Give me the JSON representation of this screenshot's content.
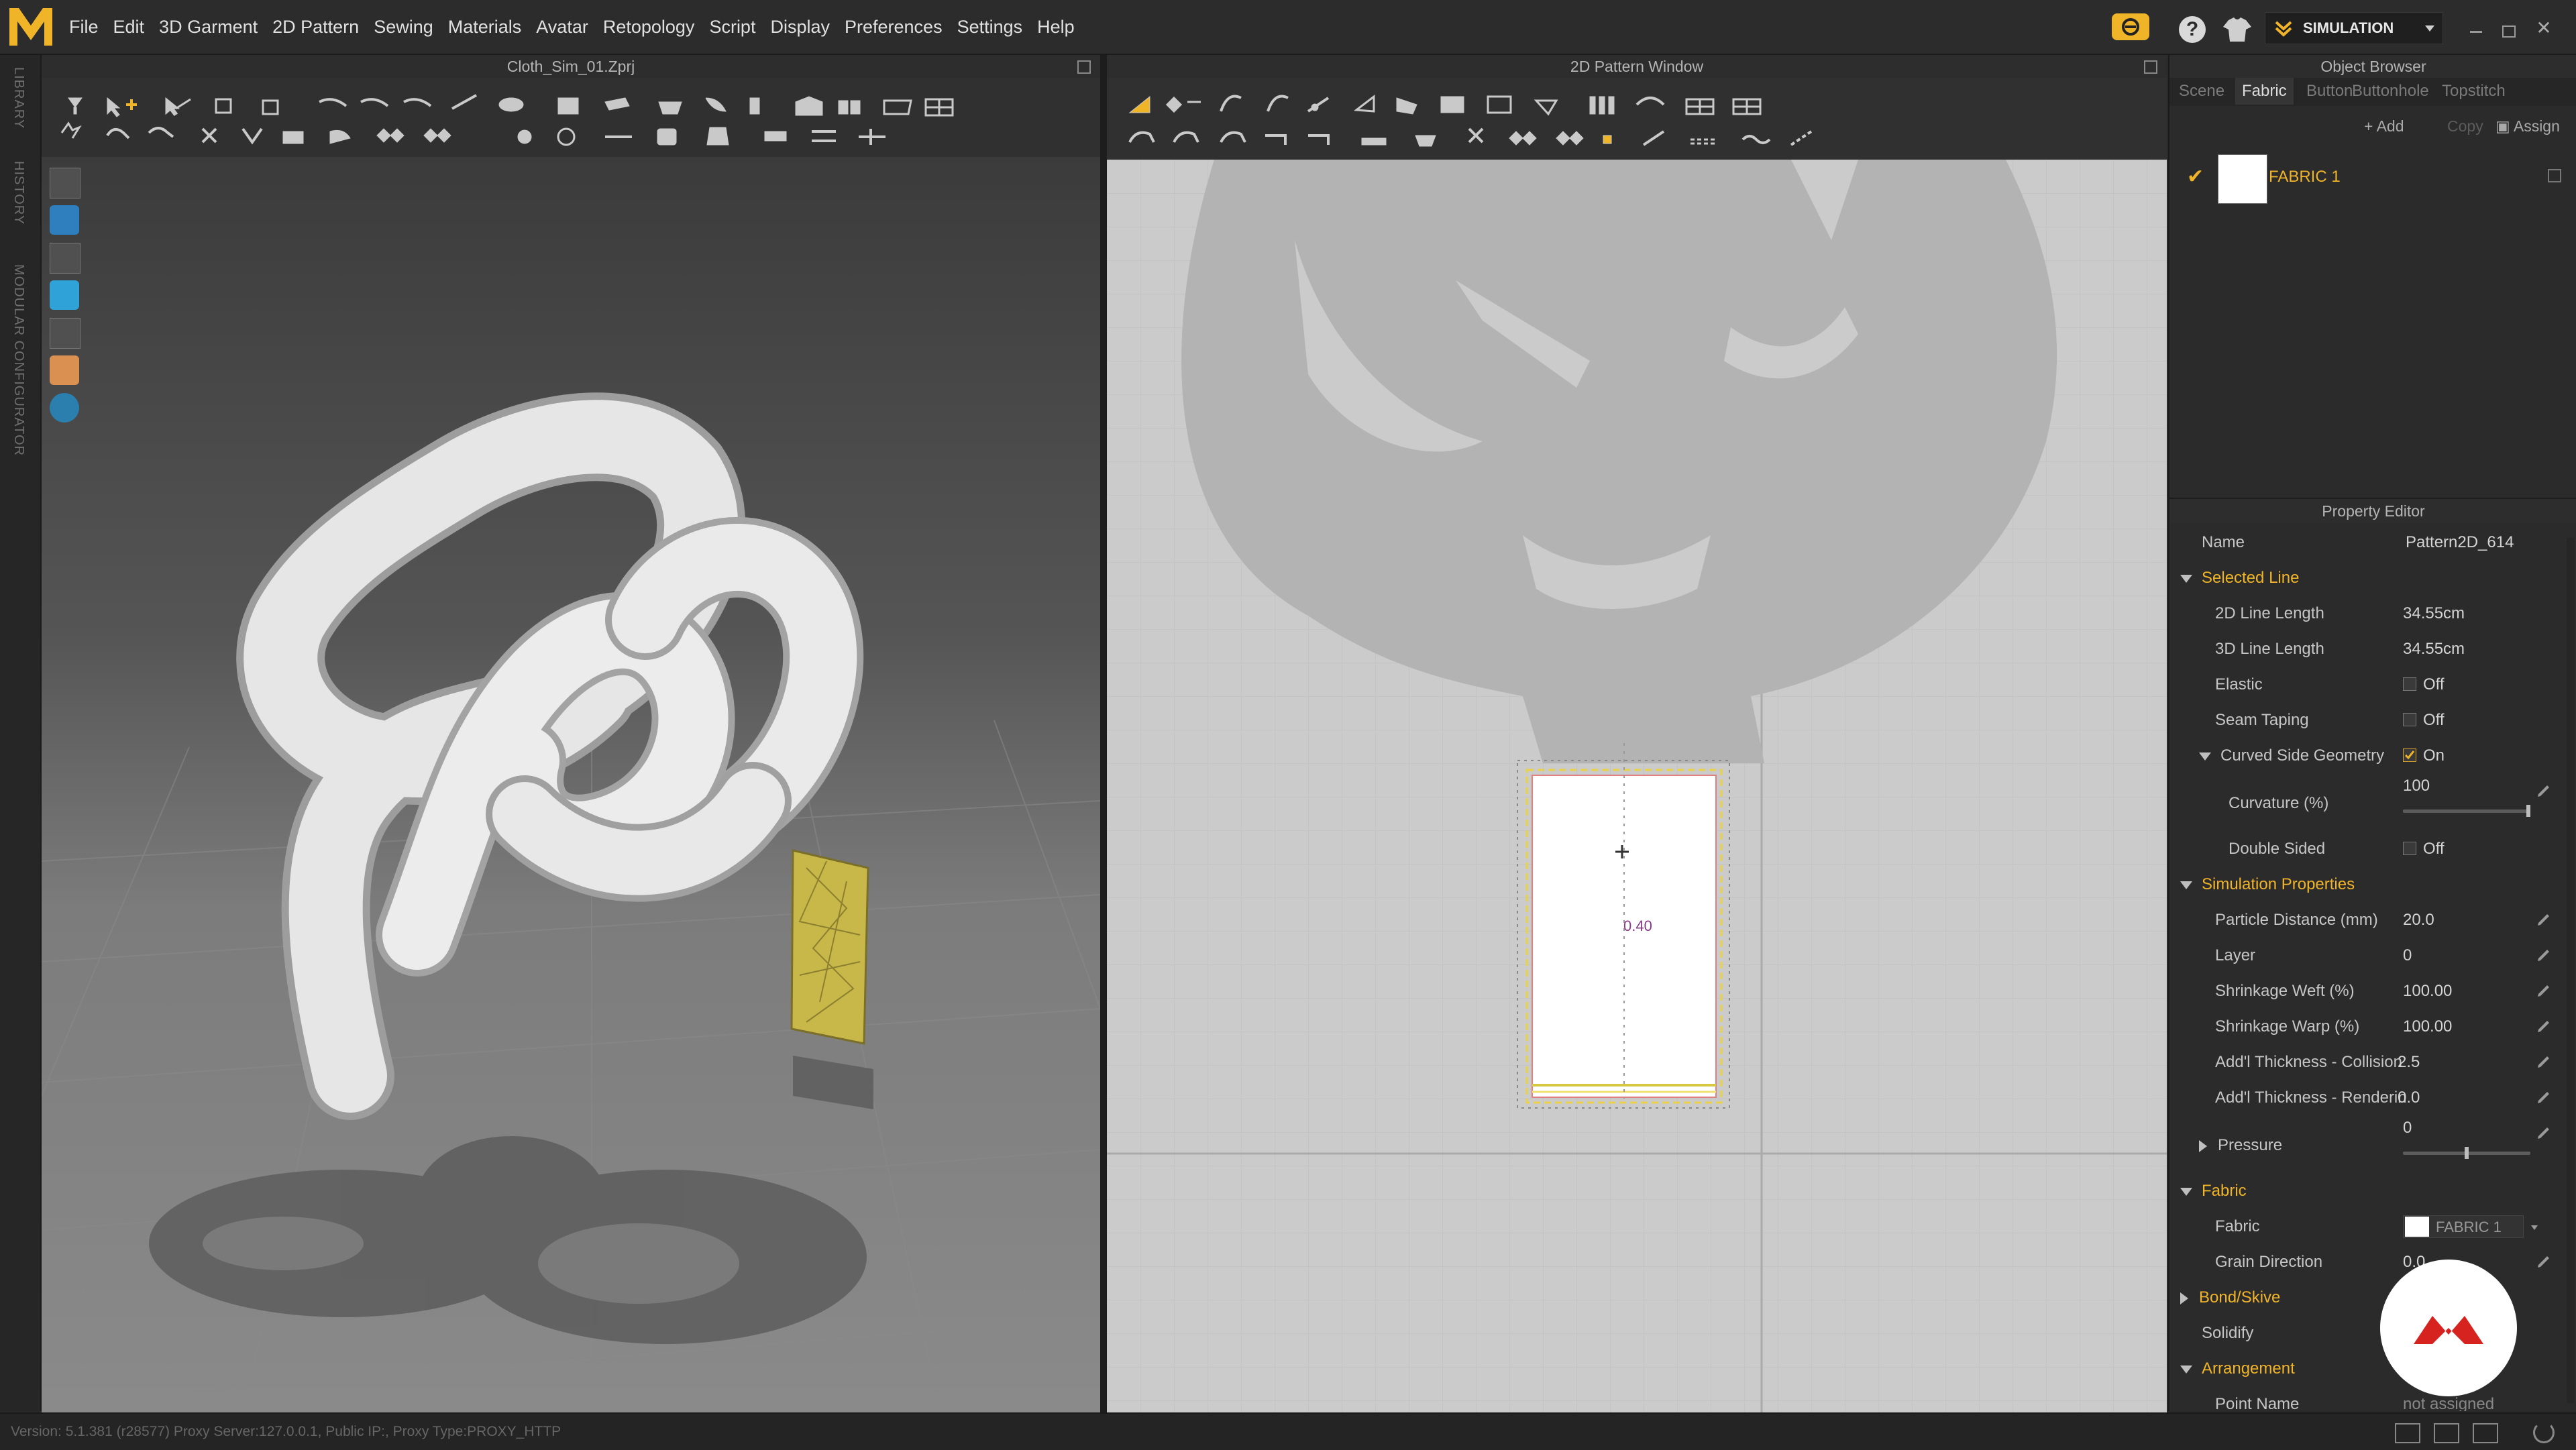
{
  "app": {
    "menu": [
      "File",
      "Edit",
      "3D Garment",
      "2D Pattern",
      "Sewing",
      "Materials",
      "Avatar",
      "Retopology",
      "Script",
      "Display",
      "Preferences",
      "Settings",
      "Help"
    ],
    "mode_label": "SIMULATION"
  },
  "side_tabs": [
    "LIBRARY",
    "HISTORY",
    "MODULAR CONFIGURATOR"
  ],
  "viewport3d": {
    "title": "Cloth_Sim_01.Zprj"
  },
  "viewport2d": {
    "title": "2D Pattern Window",
    "measure_label": "0.40"
  },
  "object_browser": {
    "title": "Object Browser",
    "tabs": [
      "Scene",
      "Fabric",
      "Button",
      "Buttonhole",
      "Topstitch"
    ],
    "active_tab": "Fabric",
    "actions": {
      "add": "Add",
      "copy": "Copy",
      "assign": "Assign"
    },
    "items": [
      {
        "name": "FABRIC 1"
      }
    ]
  },
  "property_editor": {
    "title": "Property Editor",
    "name_label": "Name",
    "name_value": "Pattern2D_614",
    "sections": {
      "selected_line": "Selected Line",
      "simulation_properties": "Simulation Properties",
      "fabric": "Fabric",
      "bond_skive": "Bond/Skive",
      "arrangement": "Arrangement"
    },
    "line2d": {
      "label": "2D Line Length",
      "value": "34.55cm"
    },
    "line3d": {
      "label": "3D Line Length",
      "value": "34.55cm"
    },
    "elastic": {
      "label": "Elastic",
      "value": "Off"
    },
    "seam_taping": {
      "label": "Seam Taping",
      "value": "Off"
    },
    "curved_side": {
      "label": "Curved Side Geometry",
      "value": "On"
    },
    "curvature": {
      "label": "Curvature (%)",
      "value": "100",
      "fraction": 1.0
    },
    "double_sided": {
      "label": "Double Sided",
      "value": "Off"
    },
    "particle_distance": {
      "label": "Particle Distance (mm)",
      "value": "20.0"
    },
    "layer": {
      "label": "Layer",
      "value": "0"
    },
    "shrink_weft": {
      "label": "Shrinkage Weft (%)",
      "value": "100.00"
    },
    "shrink_warp": {
      "label": "Shrinkage Warp (%)",
      "value": "100.00"
    },
    "thick_collision": {
      "label": "Add'l Thickness - Collision",
      "value": "2.5"
    },
    "thick_render": {
      "label": "Add'l Thickness - Renderin",
      "value": "0.0"
    },
    "pressure": {
      "label": "Pressure",
      "value": "0",
      "fraction": 0.5
    },
    "fabric_field": {
      "label": "Fabric",
      "value": "FABRIC 1"
    },
    "grain_direction": {
      "label": "Grain Direction",
      "value": "0.0"
    },
    "solidify": {
      "label": "Solidify"
    },
    "point_name": {
      "label": "Point Name",
      "value": "not assigned"
    }
  },
  "status": {
    "text": "Version: 5.1.381 (r28577)   Proxy Server:127.0.0.1, Public IP:, Proxy Type:PROXY_HTTP"
  },
  "colors": {
    "accent": "#f0b429",
    "viewport2d_bg": "#cbcbcb"
  }
}
